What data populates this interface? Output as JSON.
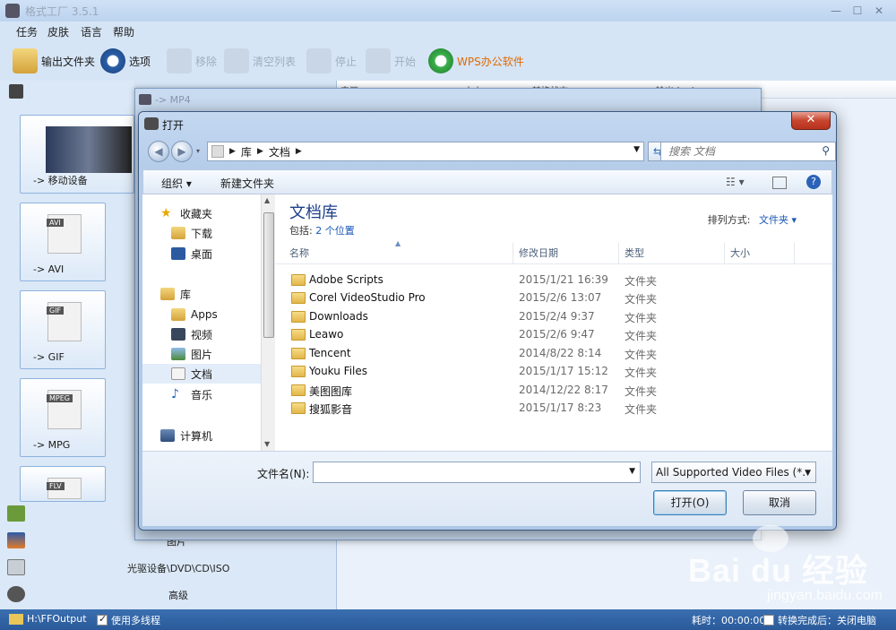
{
  "app": {
    "title": "格式工厂 3.5.1",
    "menu": [
      "任务",
      "皮肤",
      "语言",
      "帮助"
    ],
    "toolbar": {
      "output_folder": "输出文件夹",
      "options": "选项",
      "remove": "移除",
      "clear_list": "清空列表",
      "stop": "停止",
      "start": "开始",
      "wps": "WPS办公软件"
    },
    "tiles": {
      "mobile": "-> 移动设备",
      "avi": "-> AVI",
      "gif": "-> GIF",
      "mpg": "-> MPG",
      "avi_tag": "AVI",
      "gif_tag": "GIF",
      "mpeg_tag": "MPEG",
      "flv_tag": "FLV"
    },
    "categories": {
      "picture": "图片",
      "optical": "光驱设备\\DVD\\CD\\ISO",
      "advanced": "高级"
    },
    "list_header": {
      "source": "来源",
      "size": "大小",
      "state": "转换状态",
      "output": "输出 [F2]"
    },
    "status": {
      "output_path": "H:\\FFOutput",
      "multithread": "使用多线程",
      "elapsed": "耗时：00:00:00",
      "after_done": "转换完成后：关闭电脑"
    },
    "window_controls": [
      "—",
      "☐",
      "✕"
    ]
  },
  "mp4_window": {
    "title": "-> MP4"
  },
  "dialog": {
    "title": "打开",
    "close": "✕",
    "address": {
      "crumbs": [
        "库",
        "文档"
      ]
    },
    "search_placeholder": "搜索 文档",
    "commands": {
      "organize": "组织 ▾",
      "new_folder": "新建文件夹"
    },
    "nav": [
      {
        "label": "收藏夹",
        "icon": "star-icon"
      },
      {
        "label": "下载",
        "icon": "downloads-folder-icon"
      },
      {
        "label": "桌面",
        "icon": "desktop-icon"
      },
      {
        "label": "库",
        "icon": "library-icon"
      },
      {
        "label": "Apps",
        "icon": "folder-icon"
      },
      {
        "label": "视频",
        "icon": "video-library-icon"
      },
      {
        "label": "图片",
        "icon": "pictures-library-icon"
      },
      {
        "label": "文档",
        "icon": "documents-library-icon",
        "selected": true
      },
      {
        "label": "音乐",
        "icon": "music-library-icon"
      },
      {
        "label": "计算机",
        "icon": "computer-icon"
      }
    ],
    "library_title": "文档库",
    "includes_prefix": "包括:",
    "includes_link": "2 个位置",
    "sort_label": "排列方式:",
    "sort_value": "文件夹 ▾",
    "columns": [
      "名称",
      "修改日期",
      "类型",
      "大小"
    ],
    "files": [
      {
        "name": "Adobe Scripts",
        "date": "2015/1/21 16:39",
        "type": "文件夹"
      },
      {
        "name": "Corel VideoStudio Pro",
        "date": "2015/2/6 13:07",
        "type": "文件夹"
      },
      {
        "name": "Downloads",
        "date": "2015/2/4 9:37",
        "type": "文件夹"
      },
      {
        "name": "Leawo",
        "date": "2015/2/6 9:47",
        "type": "文件夹"
      },
      {
        "name": "Tencent",
        "date": "2014/8/22 8:14",
        "type": "文件夹"
      },
      {
        "name": "Youku Files",
        "date": "2015/1/17 15:12",
        "type": "文件夹"
      },
      {
        "name": "美图图库",
        "date": "2014/12/22 8:17",
        "type": "文件夹"
      },
      {
        "name": "搜狐影音",
        "date": "2015/1/17 8:23",
        "type": "文件夹"
      }
    ],
    "filename_label": "文件名(N):",
    "filename_value": "",
    "filetype": "All Supported Video Files (*.",
    "open_button": "打开(O)",
    "cancel_button": "取消"
  },
  "watermark": {
    "text": "Bai du 经验",
    "sub": "jingyan.baidu.com"
  },
  "colors": {
    "accent": "#2a5a9a",
    "link": "#1a57b8",
    "library_title": "#1e3f8a"
  }
}
